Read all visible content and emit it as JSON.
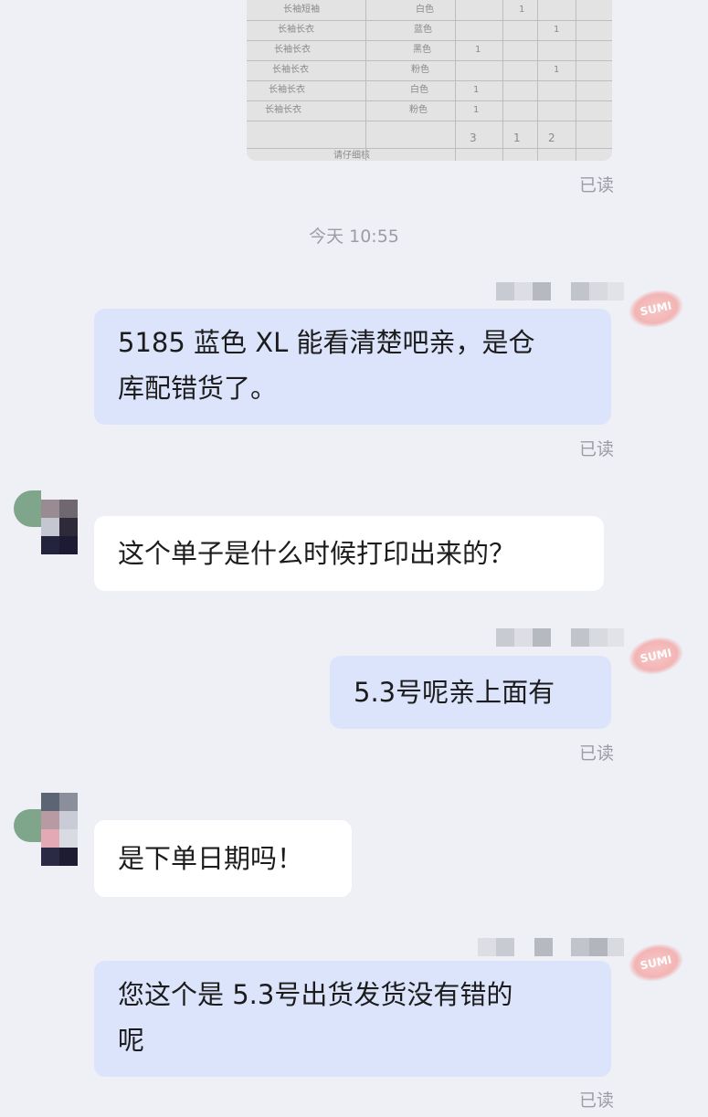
{
  "timestamp": "今天 10:55",
  "read_label": "已读",
  "stamp_text": "SUMI",
  "colors": {
    "background": "#eef0f6",
    "my_bubble": "#dbe4fb",
    "their_bubble": "#ffffff",
    "meta_text": "#9c9ca4"
  },
  "photo": {
    "rows": [
      {
        "item": "长袖短袖",
        "color": "白色",
        "q3": "1"
      },
      {
        "item": "长袖长衣",
        "color": "蓝色",
        "q4": "1"
      },
      {
        "item": "长袖长衣",
        "color": "黑色",
        "q2": "1"
      },
      {
        "item": "长袖长衣",
        "color": "粉色",
        "q4": "1"
      },
      {
        "item": "长袖长衣",
        "color": "白色",
        "q2": "1"
      },
      {
        "item": "长袖长衣",
        "color": "粉色",
        "q2": "1"
      }
    ],
    "totals": [
      "3",
      "1",
      "2"
    ],
    "footer": "请仔细核"
  },
  "messages": [
    {
      "text_line1": "5185 蓝色 XL 能看清楚吧亲，是仓",
      "text_line2": "库配错货了。"
    },
    {
      "text": "这个单子是什么时候打印出来的？"
    },
    {
      "text": "5.3号呢亲上面有"
    },
    {
      "text": "是下单日期吗！"
    },
    {
      "text_line1": "您这个是 5.3号出货发货没有错的",
      "text_line2": "呢"
    }
  ]
}
